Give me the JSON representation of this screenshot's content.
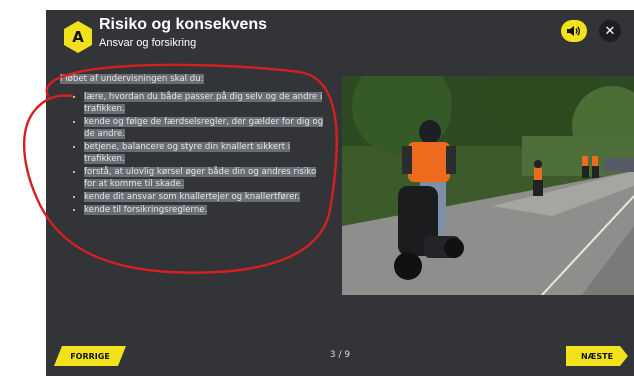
{
  "header": {
    "badge_letter": "A",
    "title": "Risiko og konsekvens",
    "subtitle": "Ansvar og forsikring"
  },
  "controls": {
    "audio_icon": "speaker-icon",
    "close_icon": "close-icon",
    "close_symbol": "✕"
  },
  "content": {
    "intro": "I løbet af undervisningen skal du:",
    "items": [
      "lære, hvordan du både passer på dig selv og de andre i trafikken.",
      "kende og følge de færdselsregler, der gælder for dig og de andre.",
      "betjene, balancere og styre din knallert sikkert i trafikken.",
      "forstå, at ulovlig kørsel øger både din og andres risiko for at komme til skade.",
      "kende dit ansvar som knallertejer og knallertfører.",
      "kende til forsikringsreglerne."
    ]
  },
  "footer": {
    "prev_label": "FORRIGE",
    "next_label": "NÆSTE",
    "page_indicator": "3 / 9"
  },
  "colors": {
    "accent": "#f2e21b",
    "panel": "#333438",
    "highlight": "#6a6d73",
    "annotation": "#d42020"
  }
}
